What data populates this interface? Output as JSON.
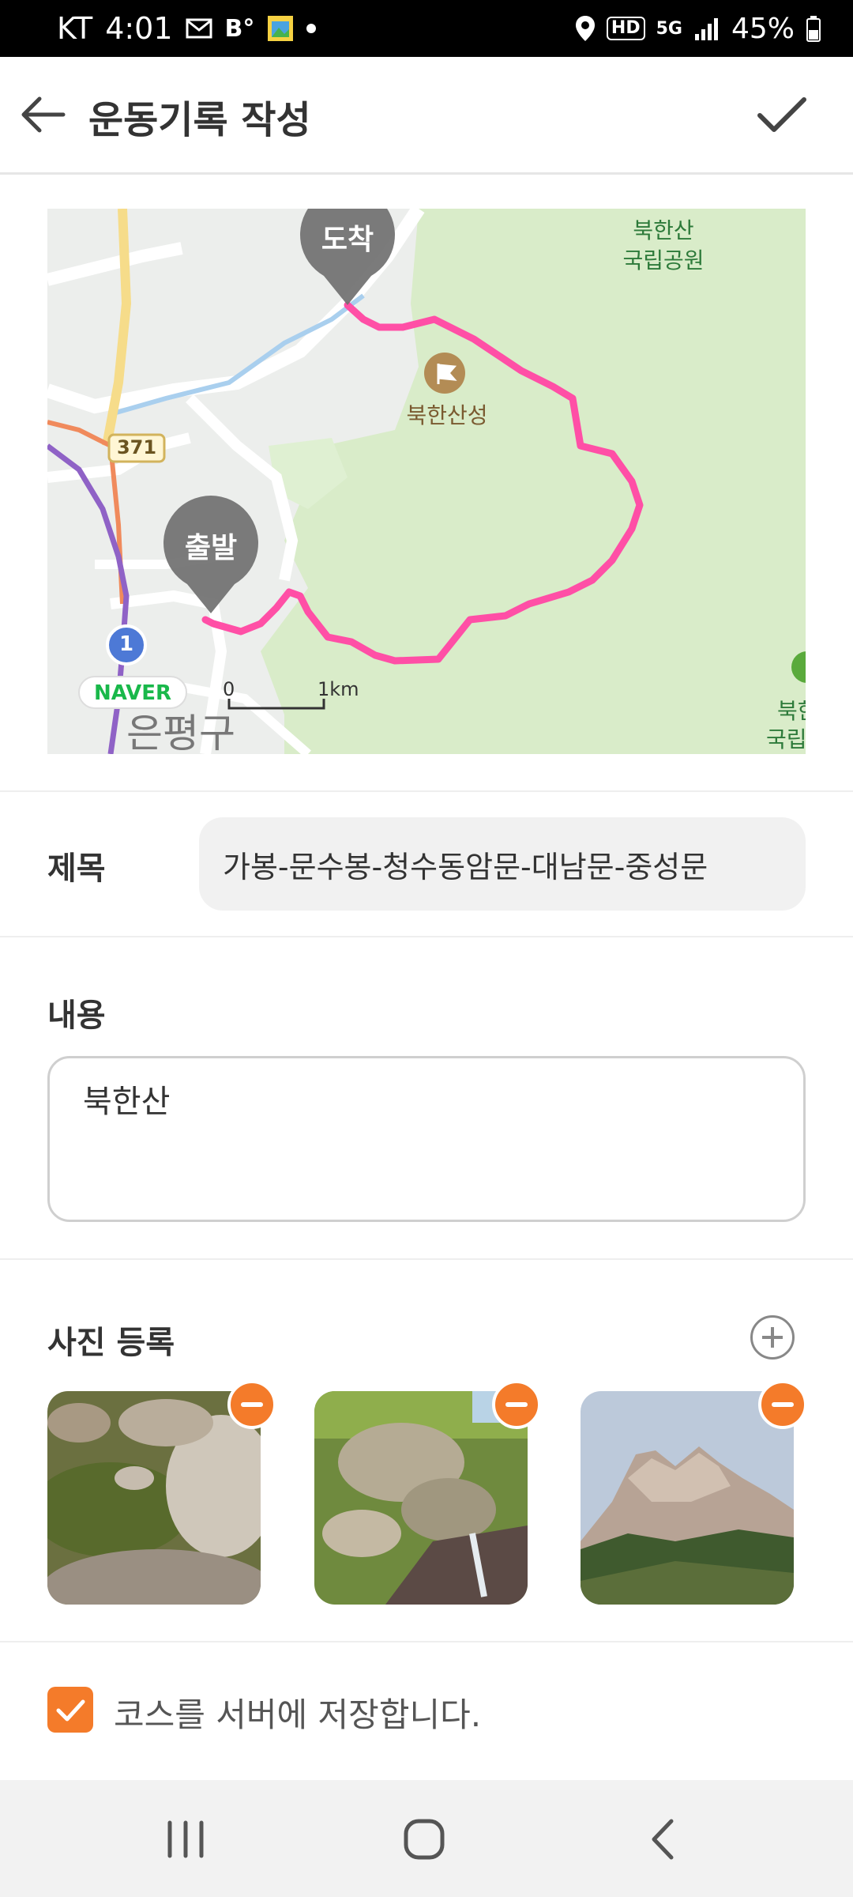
{
  "status_bar": {
    "carrier": "KT",
    "time": "4:01",
    "battery": "45%",
    "network": "5G",
    "hd": "HD",
    "icons": [
      "mail-icon",
      "b-app-icon",
      "gallery-icon",
      "notification-dot",
      "location-icon",
      "signal-icon",
      "battery-icon"
    ]
  },
  "appbar": {
    "title": "운동기록 작성",
    "back_icon": "arrow-left-icon",
    "confirm_icon": "check-icon"
  },
  "map": {
    "end_marker": "도착",
    "start_marker": "출발",
    "park_label_line1": "북한산",
    "park_label_line2": "국립공원",
    "fortress_label": "북한산성",
    "road_number": "371",
    "route_number": "1",
    "district": "은평구",
    "brand": "NAVER",
    "scale_zero": "0",
    "scale_km": "1km",
    "edge_label_line1": "북한",
    "edge_label_line2": "국립",
    "route_color": "#ff4fa6"
  },
  "form": {
    "title_label": "제목",
    "title_value": "가봉-문수봉-청수동암문-대남문-중성문",
    "content_label": "내용",
    "content_value": "북한산",
    "photos_label": "사진 등록",
    "photos": [
      {
        "name": "stream-rocks-photo"
      },
      {
        "name": "waterfall-rocks-photo"
      },
      {
        "name": "mountain-peak-photo"
      }
    ],
    "save_course_label": "코스를 서버에 저장합니다.",
    "save_course_checked": true
  },
  "colors": {
    "accent": "#f47b2a",
    "route": "#ff4fa6",
    "park_green": "#d9ecc9"
  },
  "nav_bar": {
    "icons": [
      "recent-apps-icon",
      "home-icon",
      "back-nav-icon"
    ]
  }
}
